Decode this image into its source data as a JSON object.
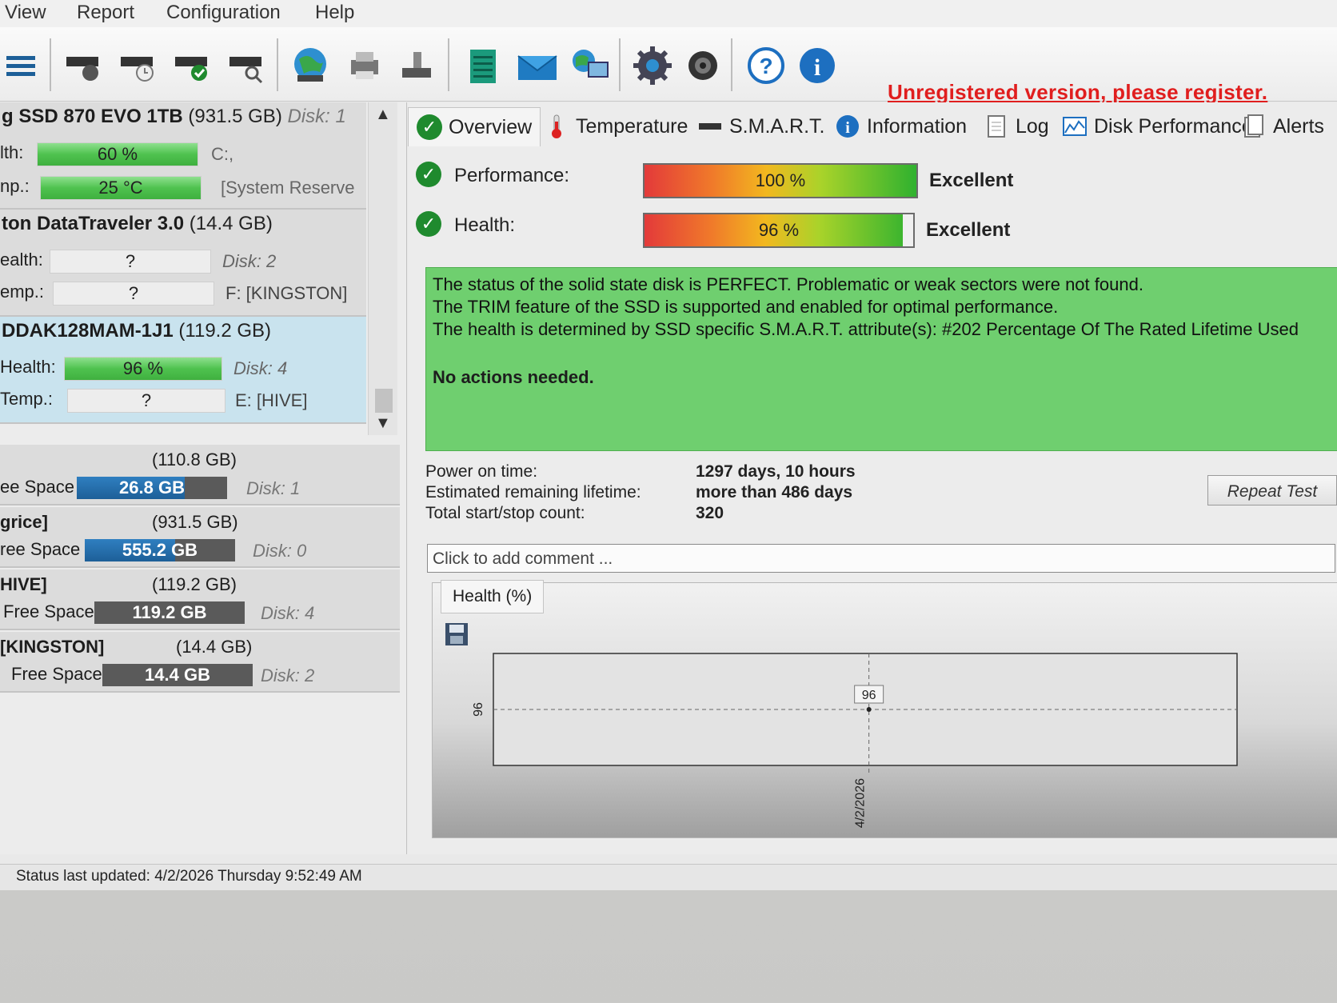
{
  "menu": [
    "View",
    "Report",
    "Configuration",
    "Help"
  ],
  "toolbar": {
    "icons": [
      "list-icon",
      "disk-refresh-icon",
      "disk-clock-icon",
      "disk-check-icon",
      "disk-search-icon",
      "globe-icon",
      "print-icon",
      "disk-export-icon",
      "notepad-icon",
      "email-icon",
      "network-icon",
      "gear-icon",
      "speaker-icon",
      "help-icon",
      "info-icon"
    ],
    "register_text": "Unregistered version, please register."
  },
  "disks": [
    {
      "name": "g SSD 870 EVO 1TB",
      "size": "(931.5 GB)",
      "disk": "Disk: 1",
      "row1_label": "lth:",
      "row1_value": "60 %",
      "row1_pct": 60,
      "row1_right": "C:,",
      "row2_label": "np.:",
      "row2_value": "25 °C",
      "row2_pct": 100,
      "row2_right": "[System Reserve"
    },
    {
      "name": "ton DataTraveler 3.0",
      "size": "(14.4 GB)",
      "disk": "Disk: 2",
      "row1_label": "ealth:",
      "row1_value": "?",
      "row1_right": "Disk: 2",
      "row2_label": "emp.:",
      "row2_value": "?",
      "row2_right": "F: [KINGSTON]"
    },
    {
      "name": "DDAK128MAM-1J1",
      "size": "(119.2 GB)",
      "row1_label": "Health:",
      "row1_value": "96 %",
      "row1_pct": 100,
      "row1_right": "Disk: 4",
      "row2_label": "Temp.:",
      "row2_value": "?",
      "row2_right": "E: [HIVE]"
    }
  ],
  "volumes": [
    {
      "name": "",
      "size": "(110.8 GB)",
      "fs_label": "ee Space",
      "free": "26.8 GB",
      "free_pct": 72,
      "disk": "Disk: 1"
    },
    {
      "name": "grice]",
      "size": "(931.5 GB)",
      "fs_label": "ree Space",
      "free": "555.2 GB",
      "free_pct": 60,
      "disk": "Disk: 0"
    },
    {
      "name": "HIVE]",
      "size": "(119.2 GB)",
      "fs_label": "Free Space",
      "free": "119.2 GB",
      "free_pct": 0,
      "disk": "Disk: 4"
    },
    {
      "name": "[KINGSTON]",
      "size": "(14.4 GB)",
      "fs_label": "Free Space",
      "free": "14.4 GB",
      "free_pct": 0,
      "disk": "Disk: 2"
    }
  ],
  "tabs": [
    "Overview",
    "Temperature",
    "S.M.A.R.T.",
    "Information",
    "Log",
    "Disk Performance",
    "Alerts"
  ],
  "overview": {
    "performance_label": "Performance:",
    "performance_value": "100 %",
    "performance_pct": 100,
    "performance_rating": "Excellent",
    "health_label": "Health:",
    "health_value": "96 %",
    "health_pct": 96,
    "health_rating": "Excellent",
    "status_lines": [
      "The status of the solid state disk is PERFECT. Problematic or weak sectors were not found.",
      "The TRIM feature of the SSD is supported and enabled for optimal performance.",
      "The health is determined by SSD specific S.M.A.R.T. attribute(s):  #202 Percentage Of The Rated Lifetime Used"
    ],
    "status_action": "No actions needed.",
    "power_on_label": "Power on time:",
    "power_on_value": "1297 days, 10 hours",
    "lifetime_label": "Estimated remaining lifetime:",
    "lifetime_value": "more than 486 days",
    "startstop_label": "Total start/stop count:",
    "startstop_value": "320",
    "repeat_button": "Repeat Test",
    "comment_placeholder": "Click to add comment ..."
  },
  "chart_tab": "Health (%)",
  "chart_data": {
    "type": "line",
    "title": "Health (%)",
    "x": [
      "4/2/2026"
    ],
    "series": [
      {
        "values": [
          96
        ]
      }
    ],
    "data_labels": [
      "96"
    ],
    "y_tick_labels": [
      "96"
    ],
    "x_tick_labels": [
      "4/2/2026"
    ],
    "grid": true
  },
  "statusbar": "Status last updated: 4/2/2026 Thursday 9:52:49 AM"
}
